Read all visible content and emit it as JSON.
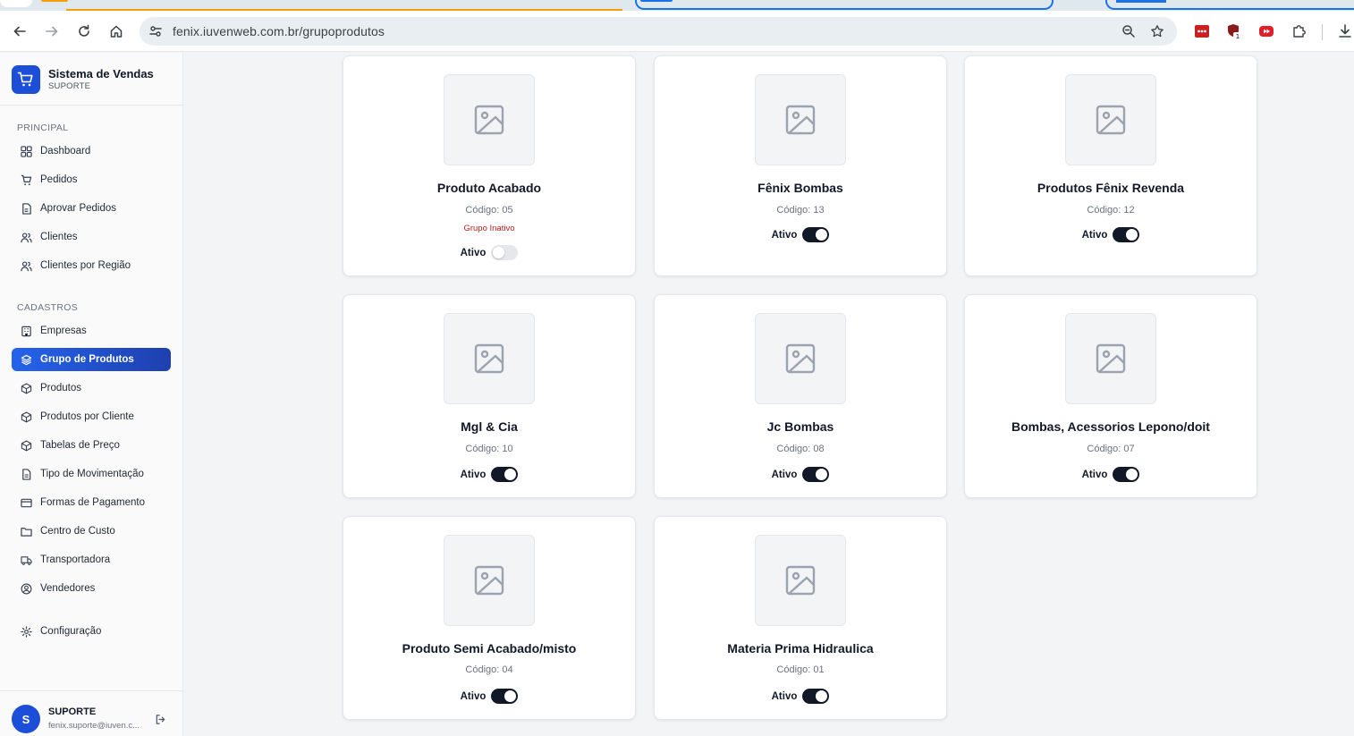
{
  "browser": {
    "url": "fenix.iuvenweb.com.br/grupoprodutos",
    "extension_badge": "1"
  },
  "sidebar": {
    "brand_title": "Sistema de Vendas",
    "brand_subtitle": "SUPORTE",
    "sections": {
      "principal": "PRINCIPAL",
      "cadastros": "CADASTROS"
    },
    "items": [
      {
        "label": "Dashboard",
        "icon": "grid-icon"
      },
      {
        "label": "Pedidos",
        "icon": "cart-icon"
      },
      {
        "label": "Aprovar Pedidos",
        "icon": "clipboard-check-icon"
      },
      {
        "label": "Clientes",
        "icon": "users-icon"
      },
      {
        "label": "Clientes por Região",
        "icon": "users-icon"
      },
      {
        "label": "Empresas",
        "icon": "building-icon"
      },
      {
        "label": "Grupo de Produtos",
        "icon": "layers-icon",
        "active": true
      },
      {
        "label": "Produtos",
        "icon": "box-icon"
      },
      {
        "label": "Produtos por Cliente",
        "icon": "box-icon"
      },
      {
        "label": "Tabelas de Preço",
        "icon": "box-icon"
      },
      {
        "label": "Tipo de Movimentação",
        "icon": "file-icon"
      },
      {
        "label": "Formas de Pagamento",
        "icon": "credit-card-icon"
      },
      {
        "label": "Centro de Custo",
        "icon": "folder-icon"
      },
      {
        "label": "Transportadora",
        "icon": "truck-icon"
      },
      {
        "label": "Vendedores",
        "icon": "user-circle-icon"
      },
      {
        "label": "Configuração",
        "icon": "gear-icon"
      }
    ],
    "user": {
      "initial": "S",
      "name": "SUPORTE",
      "email": "fenix.suporte@iuven.c..."
    }
  },
  "groups": [
    {
      "name": "Produto Acabado",
      "code": "Código: 05",
      "inactive_note": "Grupo Inativo",
      "status_label": "Ativo",
      "active": false
    },
    {
      "name": "Fênix Bombas",
      "code": "Código: 13",
      "status_label": "Ativo",
      "active": true
    },
    {
      "name": "Produtos Fênix Revenda",
      "code": "Código: 12",
      "status_label": "Ativo",
      "active": true
    },
    {
      "name": "Mgl & Cia",
      "code": "Código: 10",
      "status_label": "Ativo",
      "active": true
    },
    {
      "name": "Jc Bombas",
      "code": "Código: 08",
      "status_label": "Ativo",
      "active": true
    },
    {
      "name": "Bombas, Acessorios Lepono/doit",
      "code": "Código: 07",
      "status_label": "Ativo",
      "active": true
    },
    {
      "name": "Produto Semi Acabado/misto",
      "code": "Código: 04",
      "status_label": "Ativo",
      "active": true
    },
    {
      "name": "Materia Prima Hidraulica",
      "code": "Código: 01",
      "status_label": "Ativo",
      "active": true
    }
  ],
  "colors": {
    "accent": "#1d4ed8",
    "toggle_on": "#111827",
    "inactive_text": "#b91c1c"
  }
}
